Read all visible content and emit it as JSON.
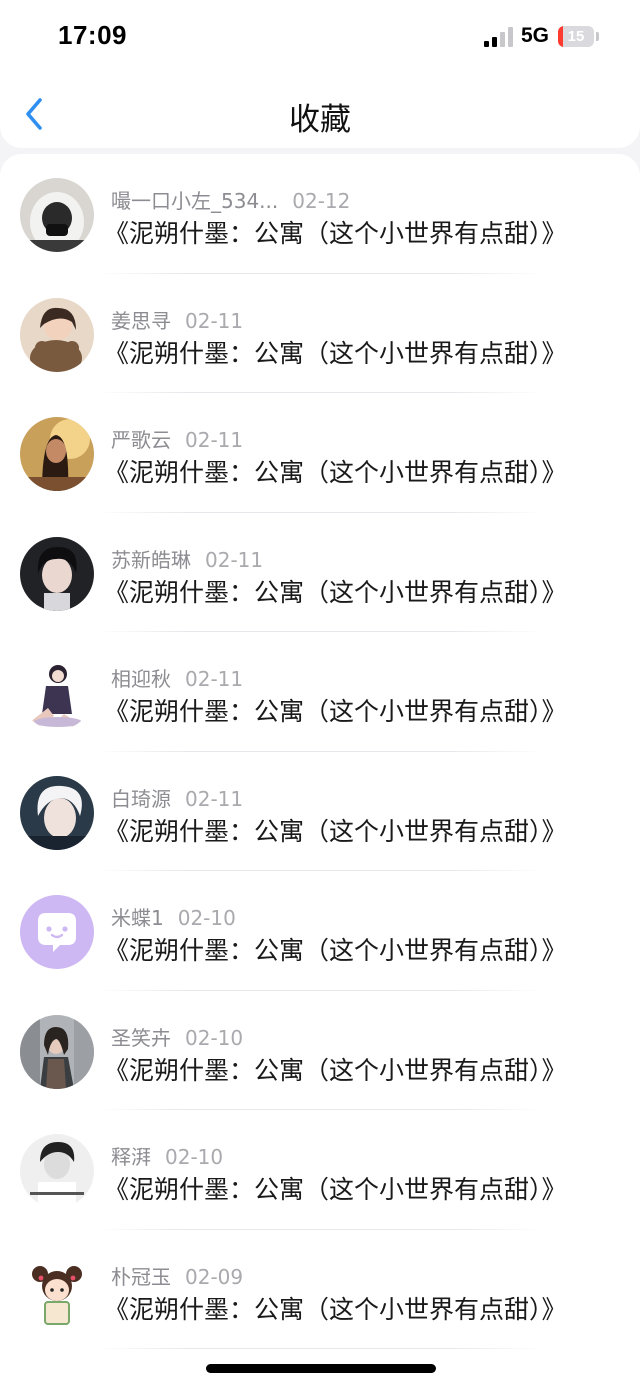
{
  "status_bar": {
    "time": "17:09",
    "network": "5G",
    "battery": "15",
    "battery_level": 0.15
  },
  "nav": {
    "title": "收藏",
    "back_icon": "chevron-left-icon"
  },
  "colors": {
    "accent": "#2f8ff0",
    "title_text": "#1a1a1a",
    "meta_text": "#8c8c92"
  },
  "items": [
    {
      "name": "嘬一口小左_534...",
      "date": "02-12",
      "title": "《泥朔什墨：公寓（这个小世界有点甜）》",
      "avatar": "avatar-hooded-person"
    },
    {
      "name": "姜思寻",
      "date": "02-11",
      "title": "《泥朔什墨：公寓（这个小世界有点甜）》",
      "avatar": "avatar-girl-bear"
    },
    {
      "name": "严歌云",
      "date": "02-11",
      "title": "《泥朔什墨：公寓（这个小世界有点甜）》",
      "avatar": "avatar-sunset-girl"
    },
    {
      "name": "苏新皓琳",
      "date": "02-11",
      "title": "《泥朔什墨：公寓（这个小世界有点甜）》",
      "avatar": "avatar-young-man"
    },
    {
      "name": "相迎秋",
      "date": "02-11",
      "title": "《泥朔什墨：公寓（这个小世界有点甜）》",
      "avatar": "avatar-anime-girl"
    },
    {
      "name": "白琦源",
      "date": "02-11",
      "title": "《泥朔什墨：公寓（这个小世界有点甜）》",
      "avatar": "avatar-white-hair"
    },
    {
      "name": "米蝶1",
      "date": "02-10",
      "title": "《泥朔什墨：公寓（这个小世界有点甜）》",
      "avatar": "avatar-default-chat"
    },
    {
      "name": "圣笑卉",
      "date": "02-10",
      "title": "《泥朔什墨：公寓（这个小世界有点甜）》",
      "avatar": "avatar-street-girl"
    },
    {
      "name": "释湃",
      "date": "02-10",
      "title": "《泥朔什墨：公寓（这个小世界有点甜）》",
      "avatar": "avatar-bw-boy"
    },
    {
      "name": "朴冠玉",
      "date": "02-09",
      "title": "《泥朔什墨：公寓（这个小世界有点甜）》",
      "avatar": "avatar-cartoon-girl"
    }
  ]
}
